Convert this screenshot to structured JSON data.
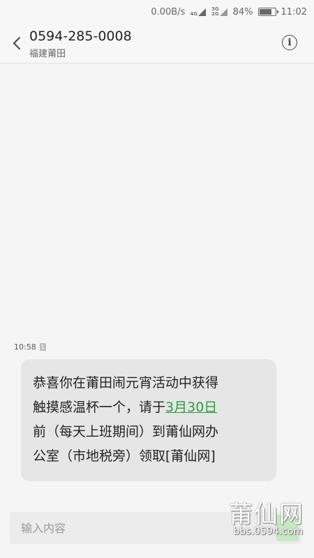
{
  "status_bar": {
    "speed": "0.00B/s",
    "network_1": "4G",
    "network_2": "3G",
    "network_2b": "2G",
    "battery_text": "84%",
    "battery_level": 0.84,
    "time": "11:02",
    "icons": [
      "signal-icon",
      "battery-icon"
    ]
  },
  "header": {
    "contact_number": "0594-285-0008",
    "contact_location": "福建莆田",
    "icons": [
      "chevron-left-icon",
      "info-icon"
    ]
  },
  "message": {
    "timestamp": "10:58",
    "sim_label": "1",
    "lines": [
      "恭喜你在莆田闹元宵活动中获得",
      "触摸感温杯一个，请于",
      "前（每天上班期间）到莆仙网办",
      "公室（市地税旁）领取[莆仙网]"
    ],
    "date_link": "3月30日"
  },
  "composer": {
    "placeholder": "输入内容"
  },
  "watermark": {
    "logo": "莆仙网",
    "site": "bbs.0594.com"
  },
  "colors": {
    "link": "#2e9c3c",
    "bubble": "#e6e6e6",
    "background": "#f5f5f5"
  }
}
